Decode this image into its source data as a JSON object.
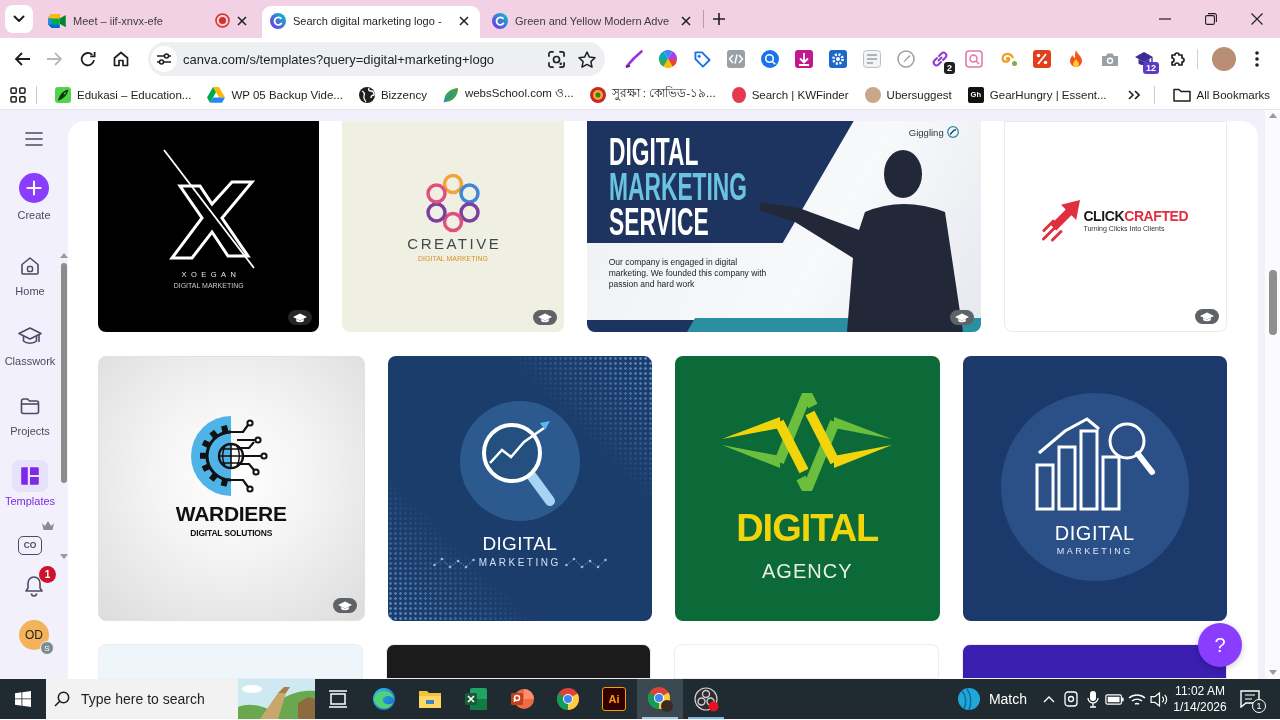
{
  "browser": {
    "tabs": [
      {
        "title": "Meet – iif-xnvx-efe",
        "kind": "video",
        "selected": false,
        "recording": true
      },
      {
        "title": "Search digital marketing logo -",
        "kind": "design",
        "selected": true,
        "recording": false
      },
      {
        "title": "Green and Yellow Modern Adve",
        "kind": "design",
        "selected": false,
        "recording": false
      }
    ],
    "nav_buttons": [
      {
        "kind": "back",
        "disabled": false
      },
      {
        "kind": "forward",
        "disabled": true
      },
      {
        "kind": "reload",
        "disabled": false
      },
      {
        "kind": "home",
        "disabled": false
      }
    ],
    "address_bar": {
      "url": "canva.com/s/templates?query=digital+marketing+logo"
    },
    "extensions": [
      {
        "kind": "pen"
      },
      {
        "kind": "wheel"
      },
      {
        "kind": "tag"
      },
      {
        "kind": "code"
      },
      {
        "kind": "disc"
      },
      {
        "kind": "download"
      },
      {
        "kind": "cog"
      },
      {
        "kind": "page"
      },
      {
        "kind": "compass"
      },
      {
        "kind": "link",
        "badge": "2"
      },
      {
        "kind": "lens"
      },
      {
        "kind": "swirl"
      },
      {
        "kind": "percent"
      },
      {
        "kind": "flame"
      },
      {
        "kind": "camera"
      },
      {
        "kind": "cap",
        "badge": "12"
      },
      {
        "kind": "puzzle"
      }
    ],
    "bookmarks": [
      {
        "label": "Edukasi – Education...",
        "kind": "leaf-tile"
      },
      {
        "label": "WP 05 Backup Vide...",
        "kind": "triangle"
      },
      {
        "label": "Bizzency",
        "kind": "globe"
      },
      {
        "label": "websSchool.com ও...",
        "kind": "leaf"
      },
      {
        "label": "সুরক্ষা : কোভিড-১৯...",
        "kind": "emblem"
      },
      {
        "label": "Search | KWFinder",
        "kind": "ball"
      },
      {
        "label": "Ubersuggest",
        "kind": "avatar"
      },
      {
        "label": "GearHungry | Essent...",
        "kind": "monogram",
        "icon_text": "Gh"
      }
    ],
    "all_bookmarks": {
      "label": "All Bookmarks"
    }
  },
  "sidebar": {
    "create": {
      "label": "Create"
    },
    "items": [
      {
        "label": "Home",
        "kind": "home",
        "selected": false
      },
      {
        "label": "Classwork",
        "kind": "cap",
        "selected": false
      },
      {
        "label": "Projects",
        "kind": "folder",
        "selected": false
      },
      {
        "label": "Templates",
        "kind": "templates",
        "selected": true
      }
    ],
    "brand_kit": {
      "icon_text": "CO"
    },
    "notifications": {
      "count": "1"
    },
    "account": {
      "initials": "OD",
      "badge": "S"
    }
  },
  "templates": [
    {
      "cards": [
        {
          "kind": "x-logo",
          "title": "XOEGAN",
          "subtitle": "DIGITAL MARKETING",
          "classroom": true
        },
        {
          "kind": "flower-logo",
          "title": "CREATIVE",
          "subtitle": "DIGITAL MARKETING",
          "classroom": true
        },
        {
          "kind": "service-banner",
          "brand": "Giggling",
          "headline": [
            {
              "text": "DIGITAL",
              "highlight": false
            },
            {
              "text": "MARKETING",
              "highlight": true
            },
            {
              "text": "SERVICE",
              "highlight": false
            }
          ],
          "body": "Our company is engaged in digital marketing. We founded this company with passion and hard work",
          "classroom": true
        },
        {
          "kind": "arrow-logo",
          "title": [
            {
              "text": "CLICK",
              "highlight": false
            },
            {
              "text": "CRAFTED",
              "highlight": true
            }
          ],
          "subtitle": "Turning Clicks Into Clients",
          "classroom": true
        }
      ]
    },
    {
      "cards": [
        {
          "kind": "gear-logo",
          "title": "WARDIERE",
          "subtitle": "DIGITAL SOLUTIONS",
          "classroom": true
        },
        {
          "kind": "magnifier-logo",
          "title": "DIGITAL",
          "subtitle": "MARKETING",
          "classroom": false
        },
        {
          "kind": "zigzag-logo",
          "title": "DIGITAL",
          "subtitle": "AGENCY",
          "classroom": false
        },
        {
          "kind": "chart-logo",
          "title": "DIGITAL",
          "subtitle": "MARKETING",
          "classroom": false
        }
      ]
    },
    {
      "cards": [
        {
          "kind": "plain",
          "color": "#eef6fb"
        },
        {
          "kind": "plain",
          "color": "#1b1b1b"
        },
        {
          "kind": "plain",
          "color": "#ffffff"
        },
        {
          "kind": "plain",
          "color": "#3a1fb0"
        }
      ]
    }
  ],
  "help_button": {
    "label": "?"
  },
  "taskbar": {
    "search": {
      "placeholder": "Type here to search"
    },
    "apps": [
      {
        "kind": "task-view",
        "running": false,
        "selected": false
      },
      {
        "kind": "edge",
        "running": false,
        "selected": false
      },
      {
        "kind": "explorer",
        "running": false,
        "selected": false
      },
      {
        "kind": "excel",
        "running": false,
        "selected": false
      },
      {
        "kind": "powerpoint",
        "running": false,
        "selected": false
      },
      {
        "kind": "chrome",
        "running": false,
        "selected": false
      },
      {
        "kind": "illustrator",
        "label": "Ai",
        "running": false,
        "selected": false
      },
      {
        "kind": "chrome-profile",
        "running": true,
        "selected": true
      },
      {
        "kind": "obs",
        "running": true,
        "selected": false
      }
    ],
    "widget": {
      "label": "Match"
    },
    "clock": {
      "time": "11:02 AM",
      "date": "1/14/2026"
    },
    "notifications": {
      "count": "1"
    }
  }
}
